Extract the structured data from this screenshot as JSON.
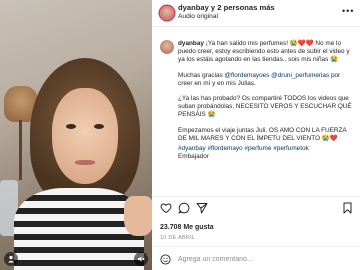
{
  "header": {
    "username_line": "dyanbay y 2 personas más",
    "audio_label": "Audio original",
    "more_icon": "more-horizontal-icon"
  },
  "caption": {
    "username": "dyanbay",
    "paragraph1_text": " ¡Ya han salido mis perfumes! 😭❤️❤️ No me lo puedo creer, estoy escribiendo esto antes de subir el video y ya los estáis agotando en las tiendas.. sois mis niñas 😭",
    "paragraph2_prefix": "Muchas gracias ",
    "mention1": "@flordemayoes",
    "paragraph2_mid": " ",
    "mention2": "@druni_perfumerias",
    "paragraph2_suffix": " por creer en mí y en mis Julias.",
    "paragraph3": "¿Ya las has probado? Os compartiré TODOS los videos que suban probándolas, NECESITO VEROS Y ESCUCHAR QUÉ PENSÁIS 😭",
    "paragraph4": "Empezamos el viaje juntas Juli. OS AMO CON LA FUERZA DE MIL MARES Y CON EL ÍMPETU DEL VIENTO 😭❤️",
    "hashtags": "#dyanbay #flordemayo #perfume #perfumetok",
    "ambassador": "Embajador"
  },
  "post": {
    "likes": "23.708 Me gusta",
    "date": "10 DE ABRIL"
  },
  "comment": {
    "placeholder": "Agrega un comentario...",
    "emoji_icon": "emoji-icon"
  },
  "video": {
    "mute_icon": "volume-off-icon",
    "tag_icon": "user-tag-icon"
  },
  "colors": {
    "link": "#00376b",
    "text": "#262626",
    "muted": "#8e8e8e",
    "story_ring": "#e1306c"
  }
}
